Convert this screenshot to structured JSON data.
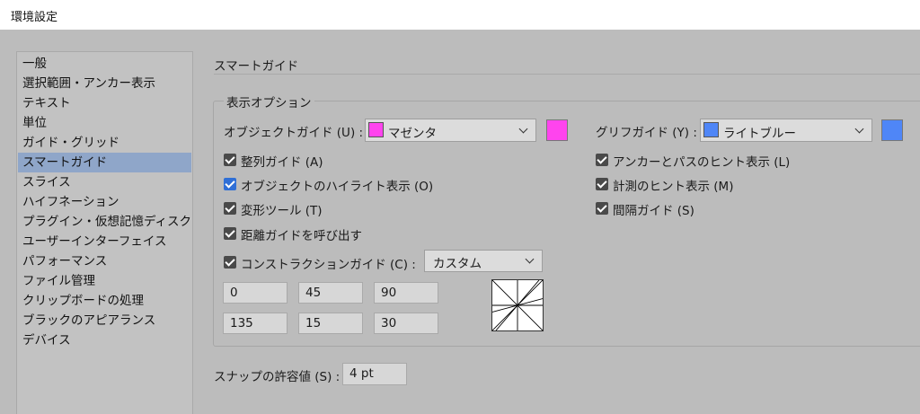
{
  "window": {
    "title": "環境設定"
  },
  "sidebar": {
    "items": [
      {
        "label": "一般",
        "selected": false
      },
      {
        "label": "選択範囲・アンカー表示",
        "selected": false
      },
      {
        "label": "テキスト",
        "selected": false
      },
      {
        "label": "単位",
        "selected": false
      },
      {
        "label": "ガイド・グリッド",
        "selected": false
      },
      {
        "label": "スマートガイド",
        "selected": true
      },
      {
        "label": "スライス",
        "selected": false
      },
      {
        "label": "ハイフネーション",
        "selected": false
      },
      {
        "label": "プラグイン・仮想記憶ディスク",
        "selected": false
      },
      {
        "label": "ユーザーインターフェイス",
        "selected": false
      },
      {
        "label": "パフォーマンス",
        "selected": false
      },
      {
        "label": "ファイル管理",
        "selected": false
      },
      {
        "label": "クリップボードの処理",
        "selected": false
      },
      {
        "label": "ブラックのアピアランス",
        "selected": false
      },
      {
        "label": "デバイス",
        "selected": false
      }
    ]
  },
  "main": {
    "section_title": "スマートガイド",
    "display_options": {
      "group_title": "表示オプション",
      "object_guide": {
        "label": "オブジェクトガイド (U) :",
        "value": "マゼンタ",
        "color": "#ff44ee"
      },
      "glyph_guide": {
        "label": "グリフガイド (Y) :",
        "value": "ライトブルー",
        "color": "#4f86f7"
      },
      "checkboxes_left": [
        {
          "label": "整列ガイド (A)",
          "checked": true
        },
        {
          "label": "オブジェクトのハイライト表示 (O)",
          "checked": true
        },
        {
          "label": "変形ツール (T)",
          "checked": true
        },
        {
          "label": "距離ガイドを呼び出す",
          "checked": true
        }
      ],
      "checkboxes_right": [
        {
          "label": "アンカーとパスのヒント表示 (L)",
          "checked": true
        },
        {
          "label": "計測のヒント表示 (M)",
          "checked": true
        },
        {
          "label": "間隔ガイド (S)",
          "checked": true
        }
      ],
      "construction_guide": {
        "label": "コンストラクションガイド (C) :",
        "checked": true,
        "value": "カスタム"
      },
      "angles": [
        "0",
        "45",
        "90",
        "135",
        "15",
        "30"
      ]
    },
    "snap_tolerance": {
      "label": "スナップの許容値 (S) :",
      "value": "4 pt"
    }
  },
  "colors": {
    "accent_checkbox": "#2f6fd6",
    "checkbox": "#4a4a4a",
    "selection": "#8fa6c9"
  }
}
